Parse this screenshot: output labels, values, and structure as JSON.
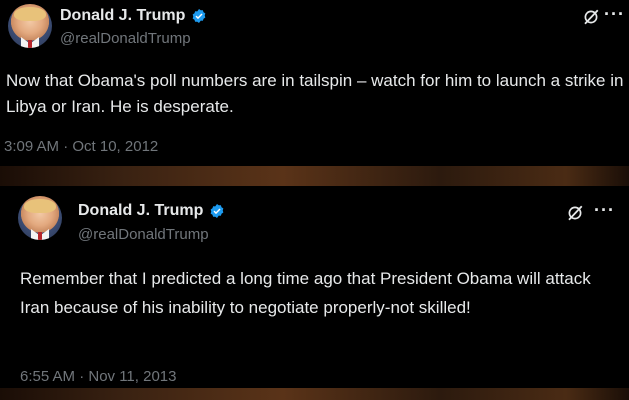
{
  "tweets": [
    {
      "display_name": "Donald J. Trump",
      "handle": "@realDonaldTrump",
      "text": "Now that Obama's poll numbers are in tailspin – watch for him to launch a strike in Libya or Iran.  He is desperate.",
      "timestamp": "3:09 AM · Oct 10, 2012",
      "more_label": "···",
      "icons": [
        "grok-icon",
        "verified-icon",
        "more-icon"
      ]
    },
    {
      "display_name": "Donald J. Trump",
      "handle": "@realDonaldTrump",
      "text": "Remember that I predicted a long time ago that President Obama will attack Iran because of his inability to negotiate properly-not skilled!",
      "timestamp": "6:55 AM · Nov 11, 2013",
      "more_label": "···",
      "icons": [
        "grok-icon",
        "verified-icon",
        "more-icon"
      ]
    }
  ],
  "colors": {
    "background": "#000000",
    "text": "#e7e9ea",
    "secondary_text": "#71767b",
    "verified": "#1d9bf0"
  }
}
